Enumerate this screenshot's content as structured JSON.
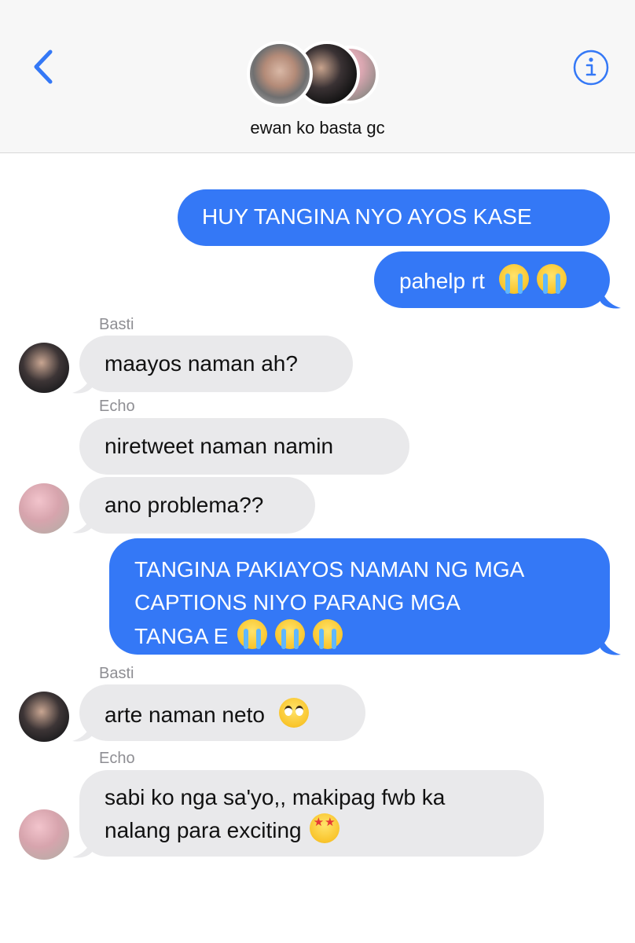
{
  "header": {
    "group_name": "ewan ko basta gc",
    "back_icon": "chevron-left-icon",
    "info_icon": "info-circle-icon",
    "accent_color": "#3478f6"
  },
  "messages": [
    {
      "direction": "outgoing",
      "text": "HUY TANGINA NYO AYOS KASE"
    },
    {
      "direction": "outgoing",
      "text": "pahelp rt",
      "emoji": [
        "loudly-crying-face",
        "loudly-crying-face"
      ]
    },
    {
      "direction": "incoming",
      "sender": "Basti",
      "text": "maayos naman ah?"
    },
    {
      "direction": "incoming",
      "sender": "Echo",
      "text": "niretweet naman namin"
    },
    {
      "direction": "incoming",
      "text": "ano problema??"
    },
    {
      "direction": "outgoing",
      "lines": [
        "TANGINA PAKIAYOS NAMAN NG MGA",
        "CAPTIONS NIYO PARANG MGA",
        "TANGA E"
      ],
      "emoji": [
        "loudly-crying-face",
        "loudly-crying-face",
        "loudly-crying-face"
      ]
    },
    {
      "direction": "incoming",
      "sender": "Basti",
      "text": "arte naman neto",
      "emoji": [
        "face-with-rolling-eyes"
      ]
    },
    {
      "direction": "incoming",
      "sender": "Echo",
      "lines": [
        "sabi ko nga sa'yo,, makipag fwb ka",
        "nalang para exciting"
      ],
      "emoji": [
        "star-struck-face"
      ]
    }
  ],
  "colors": {
    "outgoing_bubble": "#3478f6",
    "incoming_bubble": "#e9e9eb",
    "sender_label": "#8e8e93"
  }
}
